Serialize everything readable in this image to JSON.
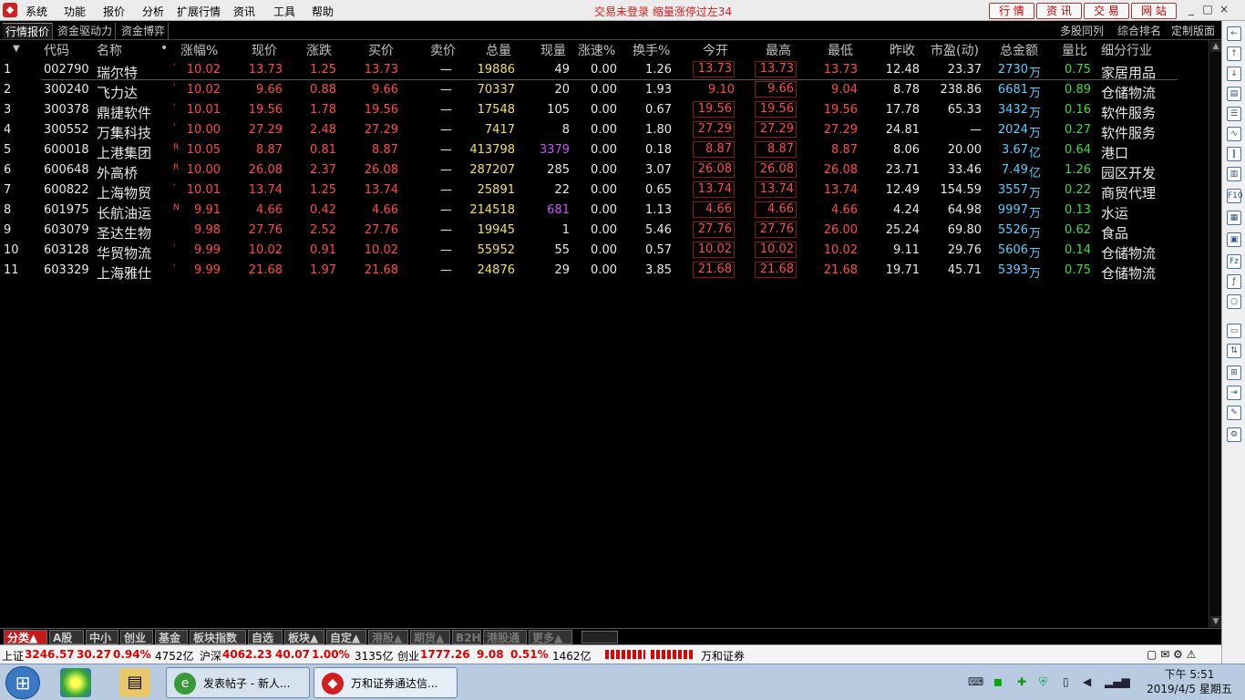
{
  "menubar": {
    "logo": "◆",
    "menus": [
      "系统",
      "功能",
      "报价",
      "分析",
      "扩展行情",
      "资讯",
      "工具",
      "帮助"
    ],
    "notice": "交易未登录  缩量涨停过左34",
    "buttons": [
      "行 情",
      "资 讯",
      "交 易",
      "网 站"
    ],
    "window_controls": [
      "_",
      "□",
      "×"
    ]
  },
  "tabs": {
    "left": [
      "行情报价",
      "资金驱动力",
      "资金博弈"
    ],
    "right": [
      "多股同列",
      "综合排名",
      "定制版面"
    ]
  },
  "table": {
    "headers": [
      "代码",
      "名称",
      "•",
      "涨幅%",
      "现价",
      "涨跌",
      "买价",
      "卖价",
      "总量",
      "现量",
      "涨速%",
      "换手%",
      "今开",
      "最高",
      "最低",
      "昨收",
      "市盈(动)",
      "总金额",
      "量比",
      "细分行业"
    ],
    "rows": [
      {
        "idx": "1",
        "code": "002790",
        "name": "瑞尔特",
        "flag": "'",
        "chg_pct": "10.02",
        "price": "13.73",
        "chg": "1.25",
        "bid": "13.73",
        "ask": "—",
        "vol": "19886",
        "cur_vol": "49",
        "speed": "0.00",
        "turnover": "1.26",
        "open": "13.73",
        "high": "13.73",
        "low": "13.73",
        "prev": "12.48",
        "pe": "23.37",
        "amount": "2730",
        "amount_unit": "万",
        "vol_ratio": "0.75",
        "industry": "家居用品",
        "cur_purple": false
      },
      {
        "idx": "2",
        "code": "300240",
        "name": "飞力达",
        "flag": "'",
        "chg_pct": "10.02",
        "price": "9.66",
        "chg": "0.88",
        "bid": "9.66",
        "ask": "—",
        "vol": "70337",
        "cur_vol": "20",
        "speed": "0.00",
        "turnover": "1.93",
        "open": "9.10",
        "high": "9.66",
        "low": "9.04",
        "prev": "8.78",
        "pe": "238.86",
        "amount": "6681",
        "amount_unit": "万",
        "vol_ratio": "0.89",
        "industry": "仓储物流",
        "cur_purple": false
      },
      {
        "idx": "3",
        "code": "300378",
        "name": "鼎捷软件",
        "flag": "'",
        "chg_pct": "10.01",
        "price": "19.56",
        "chg": "1.78",
        "bid": "19.56",
        "ask": "—",
        "vol": "17548",
        "cur_vol": "105",
        "speed": "0.00",
        "turnover": "0.67",
        "open": "19.56",
        "high": "19.56",
        "low": "19.56",
        "prev": "17.78",
        "pe": "65.33",
        "amount": "3432",
        "amount_unit": "万",
        "vol_ratio": "0.16",
        "industry": "软件服务",
        "cur_purple": false
      },
      {
        "idx": "4",
        "code": "300552",
        "name": "万集科技",
        "flag": "'",
        "chg_pct": "10.00",
        "price": "27.29",
        "chg": "2.48",
        "bid": "27.29",
        "ask": "—",
        "vol": "7417",
        "cur_vol": "8",
        "speed": "0.00",
        "turnover": "1.80",
        "open": "27.29",
        "high": "27.29",
        "low": "27.29",
        "prev": "24.81",
        "pe": "—",
        "amount": "2024",
        "amount_unit": "万",
        "vol_ratio": "0.27",
        "industry": "软件服务",
        "cur_purple": false
      },
      {
        "idx": "5",
        "code": "600018",
        "name": "上港集团",
        "flag": "R",
        "chg_pct": "10.05",
        "price": "8.87",
        "chg": "0.81",
        "bid": "8.87",
        "ask": "—",
        "vol": "413798",
        "cur_vol": "3379",
        "speed": "0.00",
        "turnover": "0.18",
        "open": "8.87",
        "high": "8.87",
        "low": "8.87",
        "prev": "8.06",
        "pe": "20.00",
        "amount": "3.67",
        "amount_unit": "亿",
        "vol_ratio": "0.64",
        "industry": "港口",
        "cur_purple": true
      },
      {
        "idx": "6",
        "code": "600648",
        "name": "外高桥",
        "flag": "R",
        "chg_pct": "10.00",
        "price": "26.08",
        "chg": "2.37",
        "bid": "26.08",
        "ask": "—",
        "vol": "287207",
        "cur_vol": "285",
        "speed": "0.00",
        "turnover": "3.07",
        "open": "26.08",
        "high": "26.08",
        "low": "26.08",
        "prev": "23.71",
        "pe": "33.46",
        "amount": "7.49",
        "amount_unit": "亿",
        "vol_ratio": "1.26",
        "industry": "园区开发",
        "cur_purple": false
      },
      {
        "idx": "7",
        "code": "600822",
        "name": "上海物贸",
        "flag": "'",
        "chg_pct": "10.01",
        "price": "13.74",
        "chg": "1.25",
        "bid": "13.74",
        "ask": "—",
        "vol": "25891",
        "cur_vol": "22",
        "speed": "0.00",
        "turnover": "0.65",
        "open": "13.74",
        "high": "13.74",
        "low": "13.74",
        "prev": "12.49",
        "pe": "154.59",
        "amount": "3557",
        "amount_unit": "万",
        "vol_ratio": "0.22",
        "industry": "商贸代理",
        "cur_purple": false
      },
      {
        "idx": "8",
        "code": "601975",
        "name": "长航油运",
        "flag": "N",
        "chg_pct": "9.91",
        "price": "4.66",
        "chg": "0.42",
        "bid": "4.66",
        "ask": "—",
        "vol": "214518",
        "cur_vol": "681",
        "speed": "0.00",
        "turnover": "1.13",
        "open": "4.66",
        "high": "4.66",
        "low": "4.66",
        "prev": "4.24",
        "pe": "64.98",
        "amount": "9997",
        "amount_unit": "万",
        "vol_ratio": "0.13",
        "industry": "水运",
        "cur_purple": true
      },
      {
        "idx": "9",
        "code": "603079",
        "name": "圣达生物",
        "flag": "",
        "chg_pct": "9.98",
        "price": "27.76",
        "chg": "2.52",
        "bid": "27.76",
        "ask": "—",
        "vol": "19945",
        "cur_vol": "1",
        "speed": "0.00",
        "turnover": "5.46",
        "open": "27.76",
        "high": "27.76",
        "low": "26.00",
        "prev": "25.24",
        "pe": "69.80",
        "amount": "5526",
        "amount_unit": "万",
        "vol_ratio": "0.62",
        "industry": "食品",
        "cur_purple": false
      },
      {
        "idx": "10",
        "code": "603128",
        "name": "华贸物流",
        "flag": "'",
        "chg_pct": "9.99",
        "price": "10.02",
        "chg": "0.91",
        "bid": "10.02",
        "ask": "—",
        "vol": "55952",
        "cur_vol": "55",
        "speed": "0.00",
        "turnover": "0.57",
        "open": "10.02",
        "high": "10.02",
        "low": "10.02",
        "prev": "9.11",
        "pe": "29.76",
        "amount": "5606",
        "amount_unit": "万",
        "vol_ratio": "0.14",
        "industry": "仓储物流",
        "cur_purple": false
      },
      {
        "idx": "11",
        "code": "603329",
        "name": "上海雅仕",
        "flag": "'",
        "chg_pct": "9.99",
        "price": "21.68",
        "chg": "1.97",
        "bid": "21.68",
        "ask": "—",
        "vol": "24876",
        "cur_vol": "29",
        "speed": "0.00",
        "turnover": "3.85",
        "open": "21.68",
        "high": "21.68",
        "low": "21.68",
        "prev": "19.71",
        "pe": "45.71",
        "amount": "5393",
        "amount_unit": "万",
        "vol_ratio": "0.75",
        "industry": "仓储物流",
        "cur_purple": false
      }
    ]
  },
  "bottom_tabs": [
    "分类▲",
    "A股",
    "中小",
    "创业",
    "基金",
    "板块指数",
    "自选",
    "板块▲",
    "自定▲",
    "港股▲",
    "期货▲",
    "B2H",
    "港股通",
    "更多▲"
  ],
  "status": {
    "sh_label": "上证",
    "sh_val": "3246.57",
    "sh_chg": "30.27",
    "sh_pct": "0.94%",
    "sh_amt": "4752亿",
    "sz_label": "沪深",
    "sz_val": "4062.23",
    "sz_chg": "40.07",
    "sz_pct": "1.00%",
    "sz_amt": "3135亿",
    "cy_label": "创业",
    "cy_val": "1777.26",
    "cy_chg": "9.08",
    "cy_pct": "0.51%",
    "cy_amt": "1462亿",
    "broker": "万和证券"
  },
  "taskbar": {
    "tasks": [
      "发表帖子 - 新人...",
      "万和证券通达信..."
    ],
    "clock_time": "下午 5:51",
    "clock_date": "2019/4/5 星期五"
  },
  "colors": {
    "up": "#ff4a4a",
    "accent": "#c81818"
  }
}
